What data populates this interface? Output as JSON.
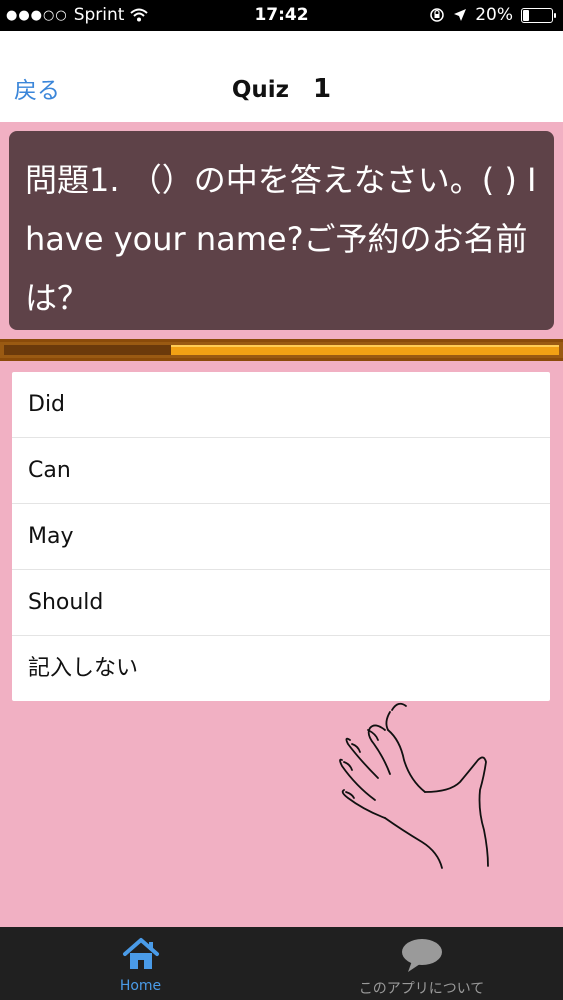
{
  "status_bar": {
    "carrier": "Sprint",
    "time": "17:42",
    "battery": "20%",
    "battery_level": 0.2
  },
  "nav": {
    "back_label": "戻る",
    "title": "Quiz",
    "number": "1"
  },
  "question": {
    "text": "問題1. （）の中を答えなさい。( ) I have your name?ご予約のお名前は？"
  },
  "progress": {
    "fraction": 0.3
  },
  "answers": [
    {
      "label": "Did"
    },
    {
      "label": "Can"
    },
    {
      "label": "May"
    },
    {
      "label": "Should"
    },
    {
      "label": "記入しない"
    }
  ],
  "tab_bar": {
    "home_label": "Home",
    "about_label": "このアプリについて",
    "active_color": "#4a9be8",
    "inactive_color": "#9a9a9a"
  },
  "colors": {
    "background": "#f1b0c3",
    "question_bg": "#5e4248",
    "accent": "#3b86d9"
  }
}
